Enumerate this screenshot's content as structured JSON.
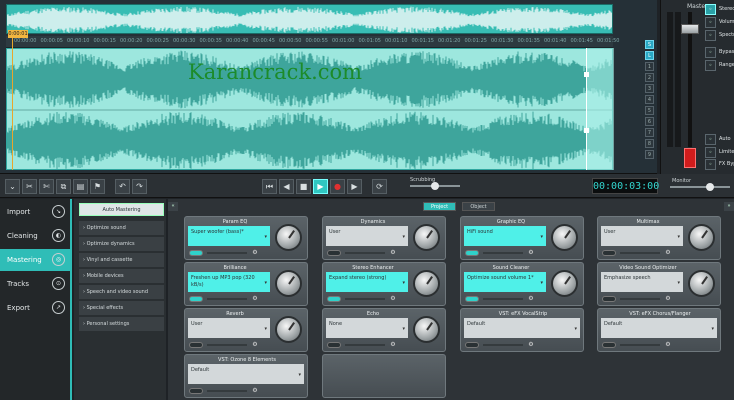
{
  "waveform": {
    "playhead_label": "0:00:01",
    "timeline_ticks": [
      "00:00:00",
      "00:00:05",
      "00:00:10",
      "00:00:15",
      "00:00:20",
      "00:00:25",
      "00:00:30",
      "00:00:35",
      "00:00:40",
      "00:00:45",
      "00:00:50",
      "00:00:55",
      "00:01:00",
      "00:01:05",
      "00:01:10",
      "00:01:15",
      "00:01:20",
      "00:01:25",
      "00:01:30",
      "00:01:35",
      "00:01:40",
      "00:01:45",
      "00:01:50"
    ],
    "watermark": "Karancrack.com",
    "track_buttons": [
      "S",
      "L",
      "1",
      "2",
      "3",
      "4",
      "5",
      "6",
      "7",
      "8",
      "9"
    ],
    "colors": {
      "wave_light": "#9de7de",
      "wave_dark": "#1f8f86",
      "accent": "#2fbdb7"
    }
  },
  "master": {
    "title": "Master",
    "meter_labels": [
      "+6",
      "0",
      "-6",
      "-12",
      "-24",
      "-48"
    ],
    "side_items": [
      {
        "icon": "stereo-icon",
        "label": "Stereo"
      },
      {
        "icon": "volume-icon",
        "label": "Volume"
      },
      {
        "icon": "spectral-icon",
        "label": "Spectral"
      },
      {
        "icon": "bypass-icon",
        "label": "Bypass"
      },
      {
        "icon": "range-icon",
        "label": "Range"
      },
      {
        "icon": "auto-icon",
        "label": "Auto"
      },
      {
        "icon": "limiter-icon",
        "label": "Limiter"
      },
      {
        "icon": "fx-bypass-icon",
        "label": "FX Bypass"
      }
    ]
  },
  "toolbar": {
    "edit_icons": [
      "collapse-icon",
      "scissors-icon",
      "cut-icon",
      "copy-icon",
      "paste-icon",
      "marker-icon",
      "undo-icon",
      "redo-icon"
    ],
    "transport_icons": [
      "rewind-start-icon",
      "previous-icon",
      "stop-icon",
      "play-icon",
      "record-icon",
      "next-icon",
      "loop-icon"
    ],
    "scrubbing_label": "Scrubbing",
    "timecode": "00:00:03:00",
    "monitor_label": "Monitor"
  },
  "nav": {
    "items": [
      {
        "label": "Import",
        "icon": "import-icon",
        "active": false
      },
      {
        "label": "Cleaning",
        "icon": "cleaning-icon",
        "active": false
      },
      {
        "label": "Mastering",
        "icon": "mastering-icon",
        "active": true
      },
      {
        "label": "Tracks",
        "icon": "tracks-icon",
        "active": false
      },
      {
        "label": "Export",
        "icon": "export-icon",
        "active": false
      }
    ]
  },
  "submenu": {
    "auto_mastering": "Auto Mastering",
    "items": [
      "Optimize sound",
      "Optimize dynamics",
      "Vinyl and cassette",
      "Mobile devices",
      "Speech and video sound",
      "Special effects",
      "Personal settings"
    ]
  },
  "effects": {
    "tabs": [
      "Project",
      "Object"
    ],
    "active_tab": "Project",
    "modules": [
      {
        "name": "Param EQ",
        "preset": "Super woofer (bass)*",
        "on": true,
        "knob": true
      },
      {
        "name": "Dynamics",
        "preset": "User",
        "on": false,
        "knob": true
      },
      {
        "name": "Graphic EQ",
        "preset": "HiFi sound",
        "on": true,
        "knob": true
      },
      {
        "name": "Multimax",
        "preset": "User",
        "on": false,
        "knob": true
      },
      {
        "name": "Brilliance",
        "preset": "Freshen up MP3 pop (320 kB/s)",
        "on": true,
        "knob": true
      },
      {
        "name": "Stereo Enhancer",
        "preset": "Expand stereo (strong)",
        "on": true,
        "knob": true
      },
      {
        "name": "Sound Cleaner",
        "preset": "Optimize sound volume 1*",
        "on": true,
        "knob": true
      },
      {
        "name": "Video Sound Optimizer",
        "preset": "Emphasize speech",
        "on": false,
        "knob": true
      },
      {
        "name": "Reverb",
        "preset": "User",
        "on": false,
        "knob": true
      },
      {
        "name": "Echo",
        "preset": "None",
        "on": false,
        "knob": true
      },
      {
        "name": "VST: eFX VocalStrip",
        "preset": "Default",
        "on": false,
        "knob": false
      },
      {
        "name": "VST: eFX Chorus/Flanger",
        "preset": "Default",
        "on": false,
        "knob": false
      },
      {
        "name": "VST: Ozone 8 Elements",
        "preset": "Default",
        "on": false,
        "knob": false
      },
      {
        "name": "",
        "preset": "",
        "on": false,
        "knob": false
      }
    ]
  }
}
